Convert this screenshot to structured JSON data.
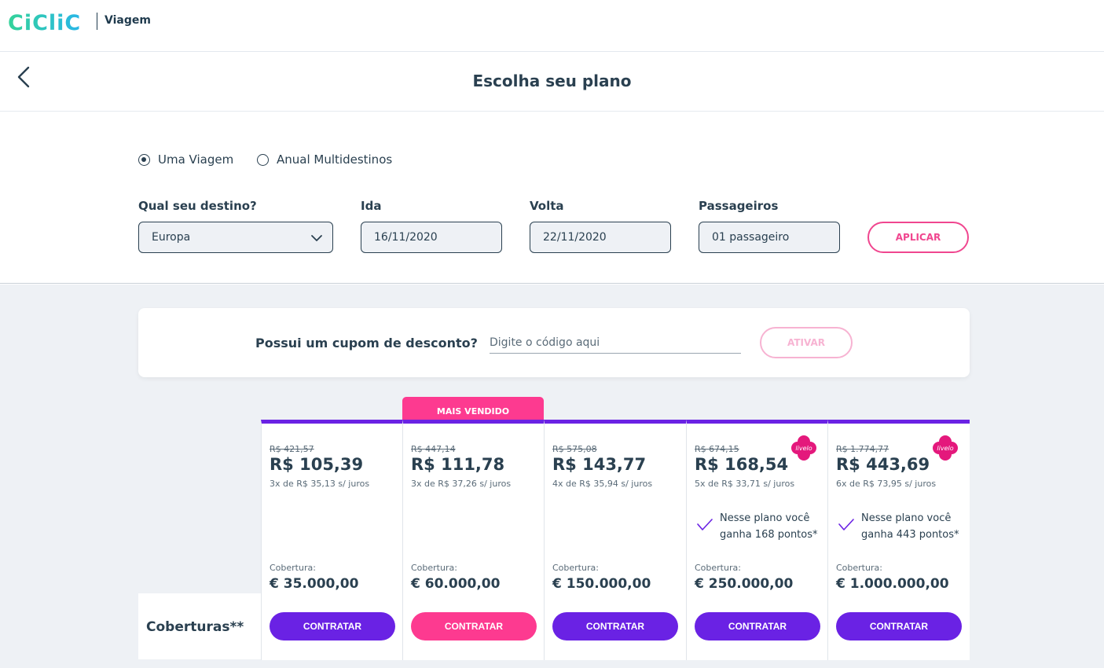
{
  "brand": {
    "logo": "CiCliC",
    "product": "Viagem",
    "colors": {
      "logo_start": "#2fd1a0",
      "logo_end": "#2fb5e8",
      "primary": "#6a22e4",
      "accent": "#fd3a90"
    }
  },
  "header": {
    "title": "Escolha seu plano",
    "back_icon": "chevron-left-icon"
  },
  "trip_type": {
    "options": [
      {
        "label": "Uma Viagem",
        "selected": true
      },
      {
        "label": "Anual Multidestinos",
        "selected": false
      }
    ]
  },
  "filters": {
    "destination": {
      "label": "Qual seu destino?",
      "value": "Europa"
    },
    "departure": {
      "label": "Ida",
      "value": "16/11/2020"
    },
    "return": {
      "label": "Volta",
      "value": "22/11/2020"
    },
    "passengers": {
      "label": "Passageiros",
      "value": "01 passageiro"
    },
    "apply_label": "APLICAR"
  },
  "coupon": {
    "label": "Possui um cupom de desconto?",
    "placeholder": "Digite o código aqui",
    "activate_label": "ATIVAR"
  },
  "plans": {
    "row_label": "Coberturas**",
    "best_seller_label": "MAIS VENDIDO",
    "coverage_label": "Cobertura:",
    "buy_label": "CONTRATAR",
    "items": [
      {
        "old_price": "R$ 421,57",
        "price": "R$ 105,39",
        "installments": "3x de R$ 35,13 s/ juros",
        "coverage": "€ 35.000,00"
      },
      {
        "old_price": "R$ 447,14",
        "price": "R$ 111,78",
        "installments": "3x de R$ 37,26 s/ juros",
        "coverage": "€ 60.000,00"
      },
      {
        "old_price": "R$ 575,08",
        "price": "R$ 143,77",
        "installments": "4x de R$ 35,94 s/ juros",
        "coverage": "€ 150.000,00"
      },
      {
        "old_price": "R$ 674,15",
        "price": "R$ 168,54",
        "installments": "5x de R$ 33,71 s/ juros",
        "coverage": "€ 250.000,00",
        "livelo": "livelo",
        "points": "Nesse plano você ganha 168 pontos*"
      },
      {
        "old_price": "R$ 1.774,77",
        "price": "R$ 443,69",
        "installments": "6x de R$ 73,95 s/ juros",
        "coverage": "€ 1.000.000,00",
        "livelo": "livelo",
        "points": "Nesse plano você ganha 443 pontos*"
      }
    ]
  }
}
